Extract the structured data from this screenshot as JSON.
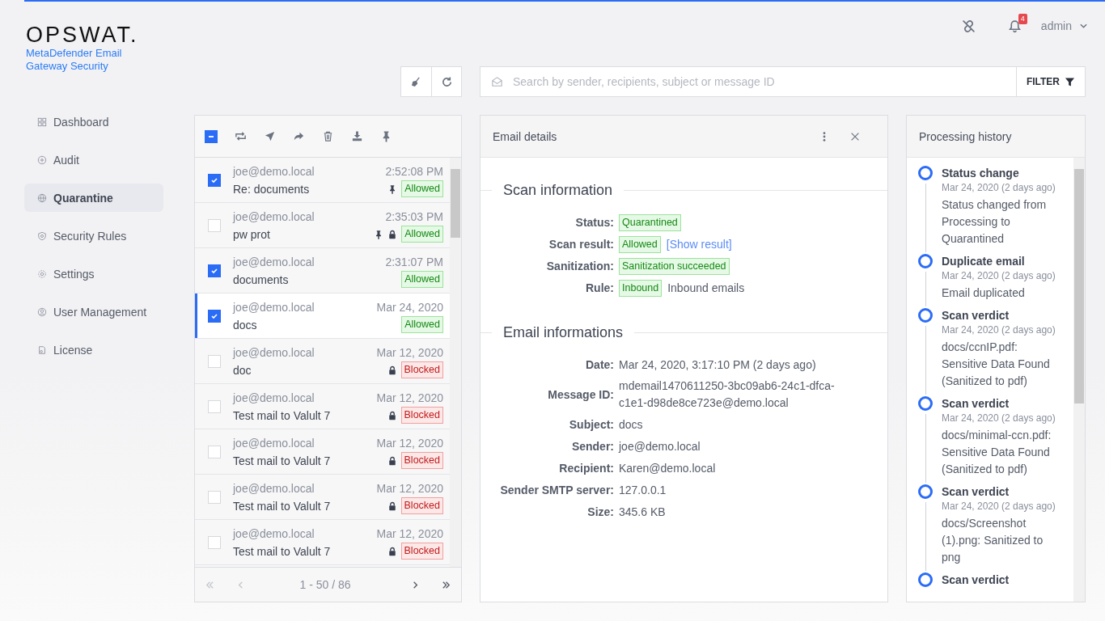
{
  "brand": {
    "logo": "OPSWAT.",
    "product": "MetaDefender Email Gateway Security"
  },
  "header": {
    "notifications": "4",
    "user": "admin"
  },
  "sidebar": {
    "items": [
      {
        "label": "Dashboard",
        "selected": false
      },
      {
        "label": "Audit",
        "selected": false
      },
      {
        "label": "Quarantine",
        "selected": true
      },
      {
        "label": "Security Rules",
        "selected": false
      },
      {
        "label": "Settings",
        "selected": false
      },
      {
        "label": "User Management",
        "selected": false
      },
      {
        "label": "License",
        "selected": false
      }
    ]
  },
  "search": {
    "placeholder": "Search by sender, recipients, subject or message ID",
    "filter_label": "FILTER"
  },
  "list": {
    "select_all_partial": true,
    "rows": [
      {
        "sender": "joe@demo.local",
        "subject": "Re: documents",
        "time": "2:52:08 PM",
        "status": "Allowed",
        "kind": "allowed",
        "pinned": true,
        "locked": false,
        "checked": true,
        "selected": false
      },
      {
        "sender": "joe@demo.local",
        "subject": "pw prot",
        "time": "2:35:03 PM",
        "status": "Allowed",
        "kind": "allowed",
        "pinned": true,
        "locked": true,
        "checked": false,
        "selected": false
      },
      {
        "sender": "joe@demo.local",
        "subject": "documents",
        "time": "2:31:07 PM",
        "status": "Allowed",
        "kind": "allowed",
        "pinned": false,
        "locked": false,
        "checked": true,
        "selected": false
      },
      {
        "sender": "joe@demo.local",
        "subject": "docs",
        "time": "Mar 24, 2020",
        "status": "Allowed",
        "kind": "allowed",
        "pinned": false,
        "locked": false,
        "checked": true,
        "selected": true
      },
      {
        "sender": "joe@demo.local",
        "subject": "doc",
        "time": "Mar 12, 2020",
        "status": "Blocked",
        "kind": "blocked",
        "pinned": false,
        "locked": true,
        "checked": false,
        "selected": false
      },
      {
        "sender": "joe@demo.local",
        "subject": "Test mail to Valult 7",
        "time": "Mar 12, 2020",
        "status": "Blocked",
        "kind": "blocked",
        "pinned": false,
        "locked": true,
        "checked": false,
        "selected": false
      },
      {
        "sender": "joe@demo.local",
        "subject": "Test mail to Valult 7",
        "time": "Mar 12, 2020",
        "status": "Blocked",
        "kind": "blocked",
        "pinned": false,
        "locked": true,
        "checked": false,
        "selected": false
      },
      {
        "sender": "joe@demo.local",
        "subject": "Test mail to Valult 7",
        "time": "Mar 12, 2020",
        "status": "Blocked",
        "kind": "blocked",
        "pinned": false,
        "locked": true,
        "checked": false,
        "selected": false
      },
      {
        "sender": "joe@demo.local",
        "subject": "Test mail to Valult 7",
        "time": "Mar 12, 2020",
        "status": "Blocked",
        "kind": "blocked",
        "pinned": false,
        "locked": true,
        "checked": false,
        "selected": false
      }
    ],
    "pagination": "1 - 50 / 86"
  },
  "details": {
    "title": "Email details",
    "scan_title": "Scan information",
    "scan_fields": [
      {
        "label": "Status:",
        "tag": "Quarantined"
      },
      {
        "label": "Scan result:",
        "tag": "Allowed",
        "link": "[Show result]"
      },
      {
        "label": "Sanitization:",
        "tag": "Sanitization succeeded"
      },
      {
        "label": "Rule:",
        "tag": "Inbound",
        "text": "Inbound emails"
      }
    ],
    "email_title": "Email informations",
    "email_fields": [
      {
        "label": "Date:",
        "value": "Mar 24, 2020, 3:17:10 PM (2 days ago)"
      },
      {
        "label": "Message ID:",
        "value": "mdemail1470611250-3bc09ab6-24c1-dfca-c1e1-d98de8ce723e@demo.local"
      },
      {
        "label": "Subject:",
        "value": "docs"
      },
      {
        "label": "Sender:",
        "value": "joe@demo.local"
      },
      {
        "label": "Recipient:",
        "value": "Karen@demo.local"
      },
      {
        "label": "Sender SMTP server:",
        "value": "127.0.0.1"
      },
      {
        "label": "Size:",
        "value": "345.6 KB"
      }
    ]
  },
  "history": {
    "title": "Processing history",
    "events": [
      {
        "title": "Status change",
        "date": "Mar 24, 2020 (2 days ago)",
        "text": "Status changed from Processing to Quarantined"
      },
      {
        "title": "Duplicate email",
        "date": "Mar 24, 2020 (2 days ago)",
        "text": "Email duplicated"
      },
      {
        "title": "Scan verdict",
        "date": "Mar 24, 2020 (2 days ago)",
        "text": "docs/ccnIP.pdf: Sensitive Data Found (Sanitized to pdf)"
      },
      {
        "title": "Scan verdict",
        "date": "Mar 24, 2020 (2 days ago)",
        "text": "docs/minimal-ccn.pdf: Sensitive Data Found (Sanitized to pdf)"
      },
      {
        "title": "Scan verdict",
        "date": "Mar 24, 2020 (2 days ago)",
        "text": "docs/Screenshot (1).png: Sanitized to png"
      },
      {
        "title": "Scan verdict"
      }
    ]
  }
}
